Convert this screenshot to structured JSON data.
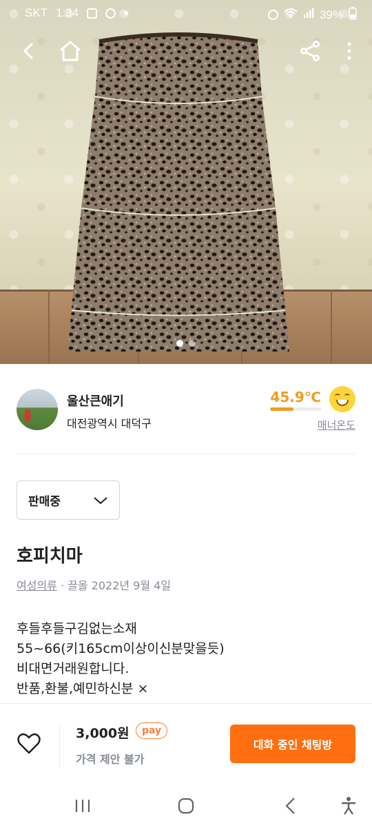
{
  "status_bar": {
    "carrier": "SKT",
    "time": "1:34",
    "battery": "39%"
  },
  "photo": {
    "page_count": 2,
    "active_index": 0
  },
  "seller": {
    "nickname": "울산큰애기",
    "location": "대전광역시 대덕구",
    "manner_temp": "45.9℃",
    "manner_temp_value": 45.9,
    "manner_label": "매너온도"
  },
  "product": {
    "status": "판매중",
    "title": "호피치마",
    "category": "여성의류",
    "date_text": " · 끌올 2022년 9월 4일",
    "description": [
      "후들후들구김없는소재",
      "55~66(키165cm이상이신분맞을듯)",
      "비대면거래원합니다.",
      "반품,환불,예민하신분 ×"
    ]
  },
  "bottom": {
    "price": "3,000원",
    "pay_badge": "pay",
    "negotiation": "가격 제안 불가",
    "chat_button": "대화 중인 채팅방"
  },
  "colors": {
    "accent": "#ff6f0f",
    "temp": "#f29c1e"
  }
}
